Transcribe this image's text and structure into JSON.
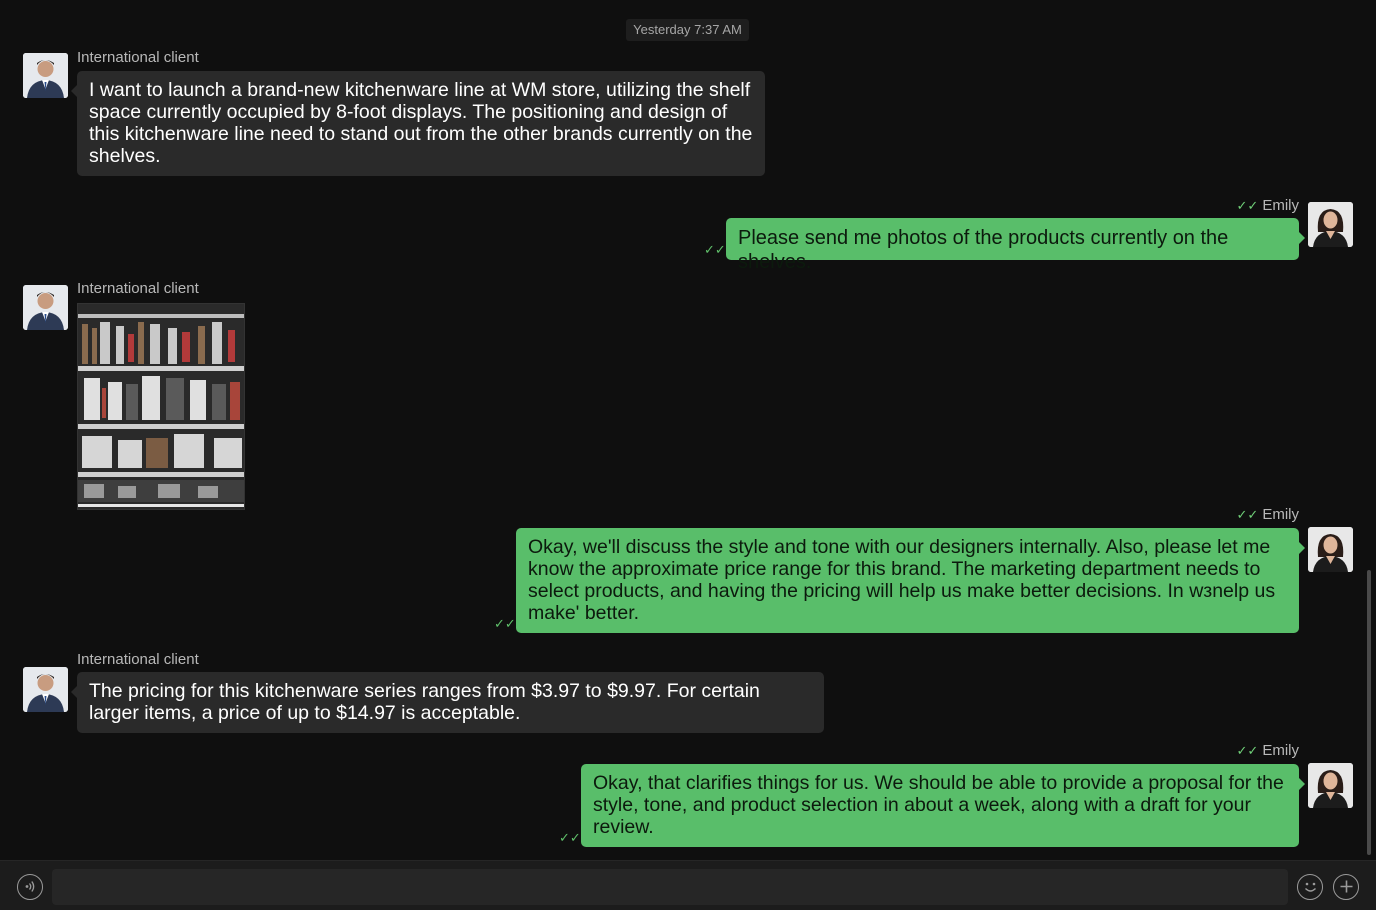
{
  "timestamp": "Yesterday 7:37 AM",
  "contact_name": "International client",
  "self_name": "Emily",
  "read_tick": "✓✓",
  "messages": [
    {
      "from": "International client",
      "text": "I want to launch a brand-new kitchenware line at WM store, utilizing the shelf space currently occupied by 8-foot displays. The positioning and design of this kitchenware line need to stand out from the other brands currently on the shelves."
    },
    {
      "from": "Emily",
      "text": "Please send me photos of the products currently on the shelves."
    },
    {
      "from": "International client",
      "type": "image",
      "image": "store-shelf-photo"
    },
    {
      "from": "Emily",
      "text": "Okay, we'll discuss the style and tone with our designers internally. Also, please let me know the approximate price range for this brand. The marketing department needs to select products, and having the pricing will help us make better decisions. In wзnelp us make' better."
    },
    {
      "from": "International client",
      "text": "The pricing for this kitchenware series ranges from $3.97 to $9.97. For certain larger items, a price of up to $14.97 is acceptable."
    },
    {
      "from": "Emily",
      "text": "Okay, that clarifies things for us. We should be able to provide a proposal for the style, tone, and product selection in about a week, along with a draft for your review."
    }
  ],
  "input": {
    "value": "",
    "placeholder": ""
  },
  "icons": {
    "voice": "voice-icon",
    "emoji": "emoji-icon",
    "plus": "plus-icon"
  },
  "colors": {
    "incoming_bubble": "#2a2a2a",
    "outgoing_bubble": "#59be6a",
    "background": "#0f0f0f"
  }
}
